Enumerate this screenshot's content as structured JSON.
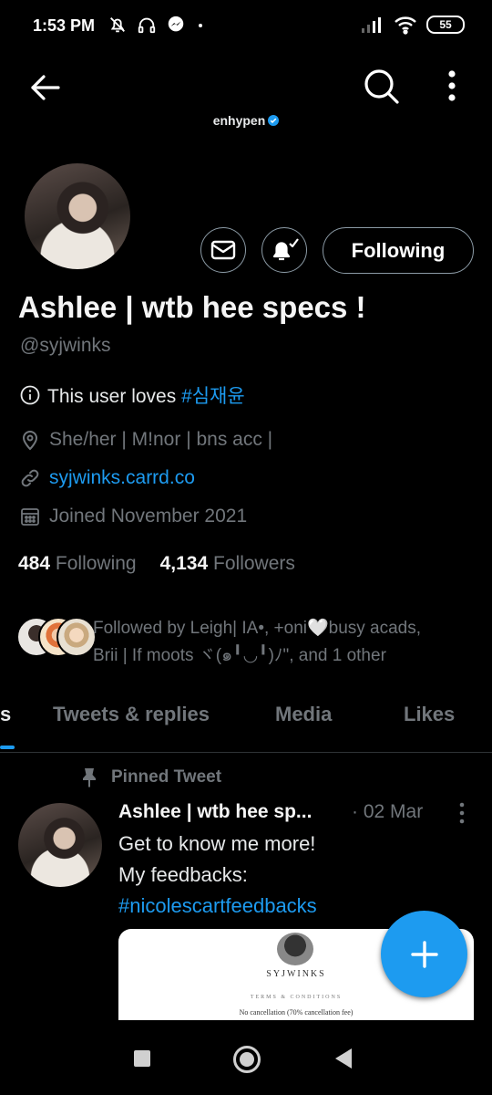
{
  "status_bar": {
    "time": "1:53 PM",
    "battery": "55",
    "icons": [
      "alarm-off-icon",
      "headphones-icon",
      "messenger-icon",
      "dot-icon",
      "signal-icon",
      "wifi-icon",
      "battery-icon"
    ]
  },
  "top_bar": {
    "title": "enhypen",
    "verified": true
  },
  "profile": {
    "display_name": "Ashlee | wtb hee specs !",
    "handle": "@syjwinks",
    "following_button": "Following",
    "bio_prefix": "This user loves ",
    "bio_hashtag": "#심재윤",
    "location": "She/her | M!nor | bns acc |",
    "website": "syjwinks.carrd.co",
    "joined": "Joined November 2021",
    "following_count": "484",
    "following_label": "Following",
    "followers_count": "4,134",
    "followers_label": "Followers",
    "followed_by_line1": "Followed by Leigh| IA•, +oni🤍busy acads,",
    "followed_by_line2": "Brii | If moots ヾ(๑╹◡╹)ﾉ\", and 1 other"
  },
  "tabs": [
    {
      "label": "s"
    },
    {
      "label": "Tweets & replies"
    },
    {
      "label": "Media"
    },
    {
      "label": "Likes"
    }
  ],
  "tweet": {
    "pinned_label": "Pinned Tweet",
    "author": "Ashlee | wtb hee sp...",
    "date": "· 02 Mar",
    "line1": "Get to know me more!",
    "line2": "My feedbacks:",
    "hashtag": "#nicolescartfeedbacks",
    "card": {
      "title": "SYJWINKS",
      "subtitle": "TERMS & CONDITIONS",
      "line": "No cancellation (70% cancellation fee)"
    }
  },
  "colors": {
    "accent": "#1d9bf0",
    "background": "#000000",
    "muted": "#71767b"
  }
}
